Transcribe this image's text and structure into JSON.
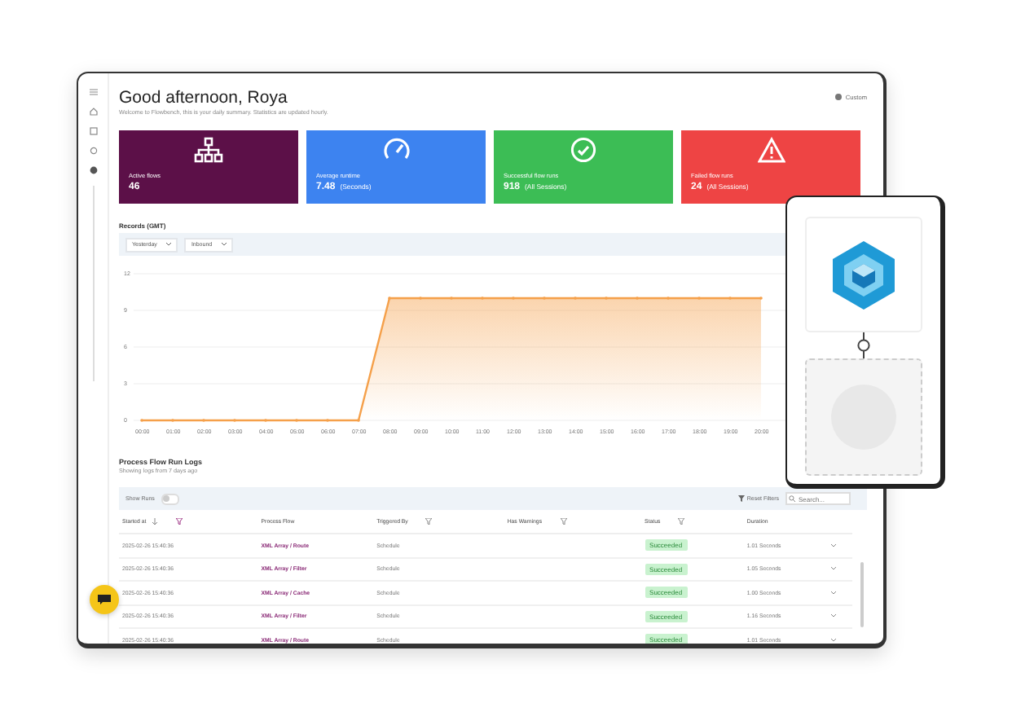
{
  "header": {
    "title": "Good afternoon, Roya",
    "subtitle": "Welcome to Flowbench, this is your daily summary. Statistics are updated hourly.",
    "custom_button": "Custom"
  },
  "stat_cards": [
    {
      "kind": "flows",
      "label": "Active flows",
      "value": "46",
      "color": "#5c1048"
    },
    {
      "kind": "runtime",
      "label": "Average runtime",
      "value": "7.48",
      "unit": "(Seconds)",
      "color": "#3d83f0"
    },
    {
      "kind": "success",
      "label": "Successful flow runs",
      "value": "918",
      "unit": "(All Sessions)",
      "color": "#3cbd55"
    },
    {
      "kind": "failed",
      "label": "Failed flow runs",
      "value": "24",
      "unit": "(All Sessions)",
      "color": "#ee4444"
    }
  ],
  "records": {
    "title": "Records (GMT)",
    "filters": [
      "Yesterday",
      "Inbound"
    ],
    "chart_data": {
      "type": "area",
      "x": [
        "00:00",
        "01:00",
        "02:00",
        "03:00",
        "04:00",
        "05:00",
        "06:00",
        "07:00",
        "08:00",
        "09:00",
        "10:00",
        "11:00",
        "12:00",
        "13:00",
        "14:00",
        "15:00",
        "16:00",
        "17:00",
        "18:00",
        "19:00",
        "20:00"
      ],
      "yticks": [
        0,
        3,
        6,
        9,
        12
      ],
      "ylim": [
        0,
        12
      ],
      "grid": true,
      "series": [
        {
          "color": "#f5a04a",
          "values": [
            0,
            0,
            0,
            0,
            0,
            0,
            0,
            0,
            10,
            10,
            10,
            10,
            10,
            10,
            10,
            10,
            10,
            10,
            10,
            10,
            10
          ]
        }
      ]
    }
  },
  "logs": {
    "title": "Process Flow Run Logs",
    "subtitle": "Showing logs from 7 days ago",
    "show_runs": {
      "label": "Show Runs",
      "on": false
    },
    "reset_filters": "Reset Filters",
    "search": {
      "placeholder": "Search..."
    },
    "columns": [
      {
        "label": "Started at",
        "sortable": true,
        "filter": true
      },
      {
        "label": "Process Flow",
        "sortable": false,
        "filter": false
      },
      {
        "label": "Triggered By",
        "sortable": false,
        "filter": true
      },
      {
        "label": "Has Warnings",
        "sortable": false,
        "filter": true
      },
      {
        "label": "Status",
        "sortable": false,
        "filter": true
      },
      {
        "label": "Duration",
        "sortable": false,
        "filter": false
      }
    ],
    "rows": [
      {
        "started": "2025-02-26 15:40:36",
        "flow": "XML Array / Route",
        "trigger": "Schedule",
        "status": "Succeeded",
        "duration": "1.01 Seconds"
      },
      {
        "started": "2025-02-26 15:40:36",
        "flow": "XML Array / Filter",
        "trigger": "Schedule",
        "status": "Succeeded",
        "duration": "1.05 Seconds"
      },
      {
        "started": "2025-02-26 15:40:36",
        "flow": "XML Array / Cache",
        "trigger": "Schedule",
        "status": "Succeeded",
        "duration": "1.00 Seconds"
      },
      {
        "started": "2025-02-26 15:40:36",
        "flow": "XML Array / Filter",
        "trigger": "Schedule",
        "status": "Succeeded",
        "duration": "1.16 Seconds"
      },
      {
        "started": "2025-02-26 15:40:36",
        "flow": "XML Array / Route",
        "trigger": "Schedule",
        "status": "Succeeded",
        "duration": "1.01 Seconds"
      }
    ]
  }
}
